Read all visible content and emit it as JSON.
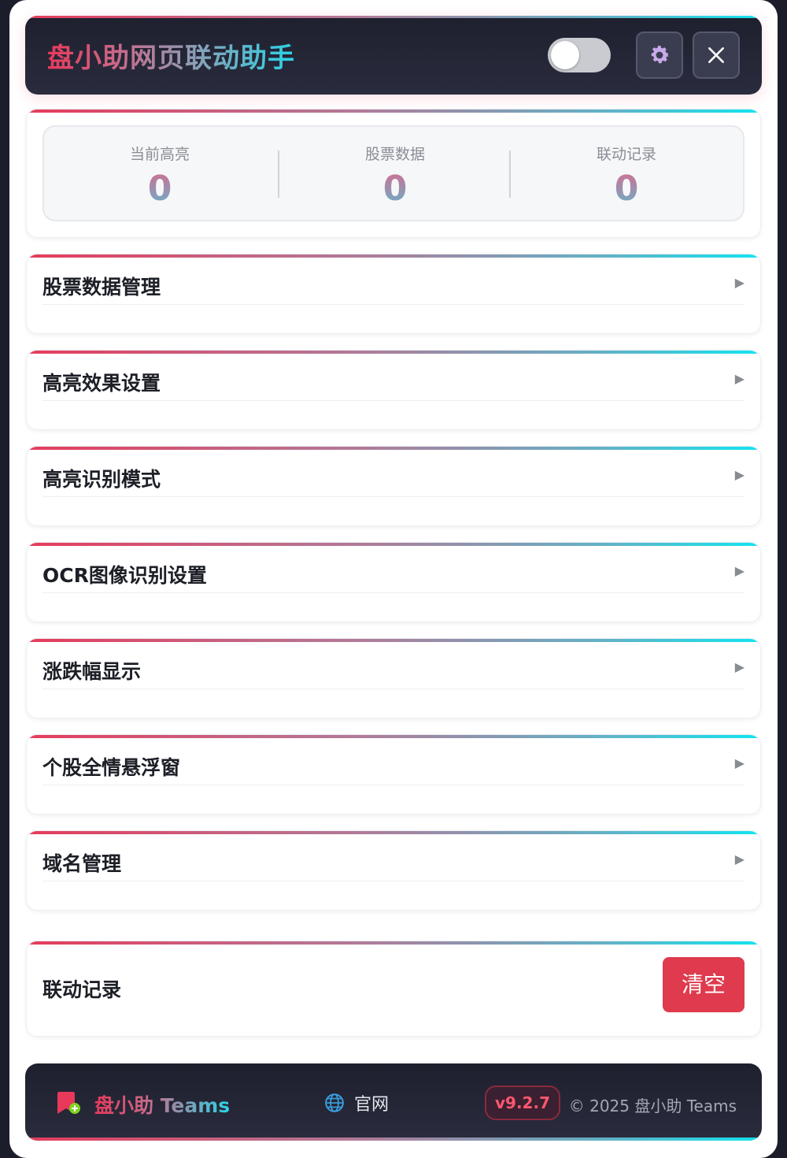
{
  "header": {
    "title": "盘小助网页联动助手",
    "toggle_icon": "toggle-switch",
    "settings_icon": "gear-icon",
    "close_icon": "close-icon"
  },
  "stats": [
    {
      "label": "当前高亮",
      "value": "0"
    },
    {
      "label": "股票数据",
      "value": "0"
    },
    {
      "label": "联动记录",
      "value": "0"
    }
  ],
  "sections": [
    {
      "title": "股票数据管理",
      "arrow": "▶"
    },
    {
      "title": "高亮效果设置",
      "arrow": "▶"
    },
    {
      "title": "高亮识别模式",
      "arrow": "▶"
    },
    {
      "title": "OCR图像识别设置",
      "arrow": "▶"
    },
    {
      "title": "涨跌幅显示",
      "arrow": "▶"
    },
    {
      "title": "个股全情悬浮窗",
      "arrow": "▶"
    },
    {
      "title": "域名管理",
      "arrow": "▶"
    }
  ],
  "log": {
    "title": "联动记录",
    "clear_label": "清空"
  },
  "footer": {
    "brand": "盘小助 Teams",
    "link_label": "官网",
    "version": "v9.2.7",
    "copyright": "© 2025 盘小助 Teams"
  },
  "colors": {
    "accent_red": "#e63c5c",
    "accent_cyan": "#12e4f0",
    "dark_bg": "#1e202e",
    "clear_button": "#df3a4d"
  }
}
